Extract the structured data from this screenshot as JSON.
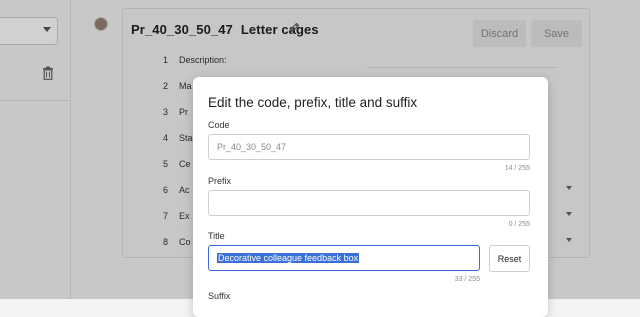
{
  "record": {
    "code": "Pr_40_30_50_47",
    "title": "Letter cages",
    "discard_label": "Discard",
    "save_label": "Save"
  },
  "rows": [
    {
      "num": "1",
      "label": "Description:"
    },
    {
      "num": "2",
      "label": "Ma"
    },
    {
      "num": "3",
      "label": "Pr"
    },
    {
      "num": "4",
      "label": "Sta"
    },
    {
      "num": "5",
      "label": "Ce"
    },
    {
      "num": "6",
      "label": "Ac"
    },
    {
      "num": "7",
      "label": "Ex"
    },
    {
      "num": "8",
      "label": "Co"
    }
  ],
  "modal": {
    "title": "Edit the code, prefix, title and suffix",
    "code_label": "Code",
    "code_placeholder": "Pr_40_30_50_47",
    "code_counter": "14 / 255",
    "prefix_label": "Prefix",
    "prefix_value": "",
    "prefix_counter": "0 / 255",
    "title_label": "Title",
    "title_value": "Decorative colleague feedback box",
    "title_counter": "33 / 255",
    "reset_label": "Reset",
    "suffix_label": "Suffix"
  },
  "icons": {
    "edit": "pencil-icon",
    "delete": "trash-icon",
    "dropdown": "chevron-down-icon"
  },
  "colors": {
    "selection": "#3a6fd8",
    "focus_border": "#3b6bd6"
  }
}
